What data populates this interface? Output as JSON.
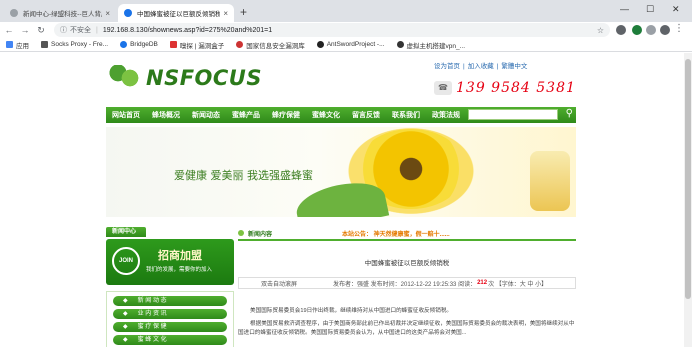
{
  "browser": {
    "tabs": [
      {
        "title": "新闻中心-绿盟科技--巨人背后的专家",
        "active": false
      },
      {
        "title": "中国蜂蜜被征以巨额反倾销税-花",
        "active": true
      }
    ],
    "new_tab": "+",
    "window_controls": [
      "—",
      "☐",
      "✕"
    ],
    "security_label": "不安全",
    "url": "192.168.8.130/shownews.asp?id=275%20and%201=1",
    "bookmarks": [
      "应用",
      "Socks Proxy - Fre...",
      "BridgeDB",
      "嗅探 | 漏洞盒子",
      "国家信息安全漏洞库",
      "AntSwordProject -...",
      "虚拟主机搭建vpn_..."
    ]
  },
  "site": {
    "logo_text": "NSFOCUS",
    "top_links": [
      "设为首页",
      "|",
      "加入收藏",
      "|",
      "繁體中文"
    ],
    "hotline": "139  9584  5381",
    "nav": [
      "网站首页",
      "蜂场概况",
      "新闻动态",
      "蜜蜂产品",
      "蜂疗保健",
      "蜜蜂文化",
      "留言反馈",
      "联系我们",
      "政策法规"
    ],
    "banner_slogan": "爱健康  爱美丽  我选强盛蜂蜜",
    "left": {
      "heading": "新闻中心",
      "join_badge": "JOIN",
      "join_title": "招商加盟",
      "join_sub": "我们的发展，需要你的加入",
      "menu": [
        "新 闻 动 态",
        "业 内 资 讯",
        "蜜 疗 保 健",
        "蜜 蜂 文 化"
      ]
    },
    "article": {
      "section_label": "新闻内容",
      "notice": "本站公告：  神天然健康蜜，假一赔十......",
      "title": "中国蜂蜜被征以巨额反倾销税",
      "meta_prefix": "双击自动滚屏",
      "meta_info": "发布者：强盛  发布时间：2012-12-22 19:25:33  阅读：",
      "hits": "212",
      "meta_suffix": "次  【字体：大  中  小】",
      "paragraphs": [
        "美国国际贸易委员会19日作出终裁，继续维持对从中国进口的蜂蜜征收反倾销税。",
        "根据美国贸易救济调查程序，由于美国商务部此前已作出初裁并决定继续征收，美国国际贸易委员会的裁决表明，美国将继续对从中国进口的蜂蜜征收反倾销税。美国国际贸易委员会认为，从中国进口的这类产品将会对美国..."
      ]
    }
  },
  "colors": {
    "brand_green": "#2f8a1a",
    "accent_red": "#e60012",
    "notice_orange": "#e57a00"
  }
}
